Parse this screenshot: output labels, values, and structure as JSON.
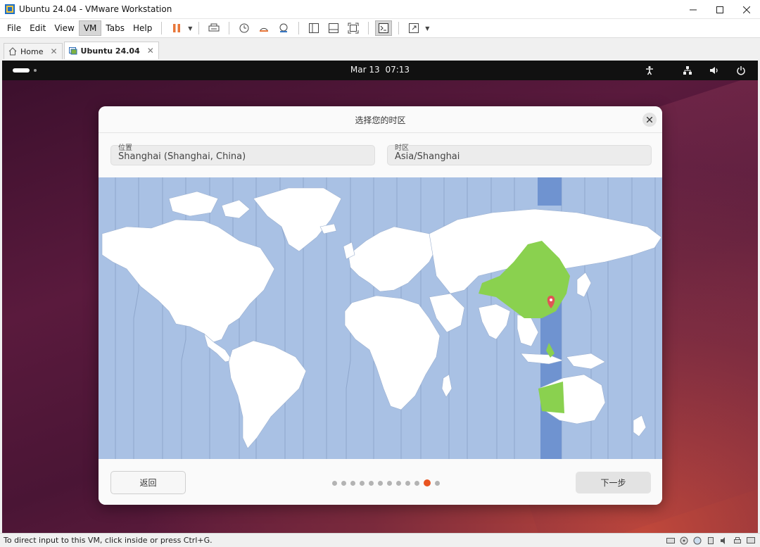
{
  "window": {
    "title": "Ubuntu 24.04 - VMware Workstation",
    "controls": [
      "minimize-icon",
      "maximize-icon",
      "close-icon"
    ]
  },
  "menubar": {
    "items": [
      {
        "label": "File",
        "active": false
      },
      {
        "label": "Edit",
        "active": false
      },
      {
        "label": "View",
        "active": false
      },
      {
        "label": "VM",
        "active": true
      },
      {
        "label": "Tabs",
        "active": false
      },
      {
        "label": "Help",
        "active": false
      }
    ],
    "toolbar_icons": [
      "pause-icon",
      "send-ctrl-alt-del-icon",
      "snapshot-icon",
      "revert-snapshot-icon",
      "snapshot-manager-icon",
      "sidebar-toggle-icon",
      "thumbnail-bar-icon",
      "fit-guest-icon",
      "console-view-icon",
      "fullscreen-icon"
    ]
  },
  "tabs": [
    {
      "label": "Home",
      "active": false
    },
    {
      "label": "Ubuntu 24.04",
      "active": true
    }
  ],
  "gnome_bar": {
    "date": "Mar 13",
    "time": "07:13",
    "tray_icons": [
      "accessibility-icon",
      "network-icon",
      "volume-icon",
      "power-icon"
    ]
  },
  "dialog": {
    "title": "选择您的时区",
    "location_label": "位置",
    "location_value": "Shanghai (Shanghai, China)",
    "timezone_label": "时区",
    "timezone_value": "Asia/Shanghai",
    "back_label": "返回",
    "next_label": "下一步",
    "pager": {
      "total": 12,
      "current": 11
    }
  },
  "colors": {
    "ocean": "#a9c1e4",
    "land": "#ffffff",
    "selected_zone": "#6f93d0",
    "selected_country": "#8ad14f",
    "marker": "#e05555",
    "accent": "#e95420"
  },
  "statusbar": {
    "text": "To direct input to this VM, click inside or press Ctrl+G."
  }
}
